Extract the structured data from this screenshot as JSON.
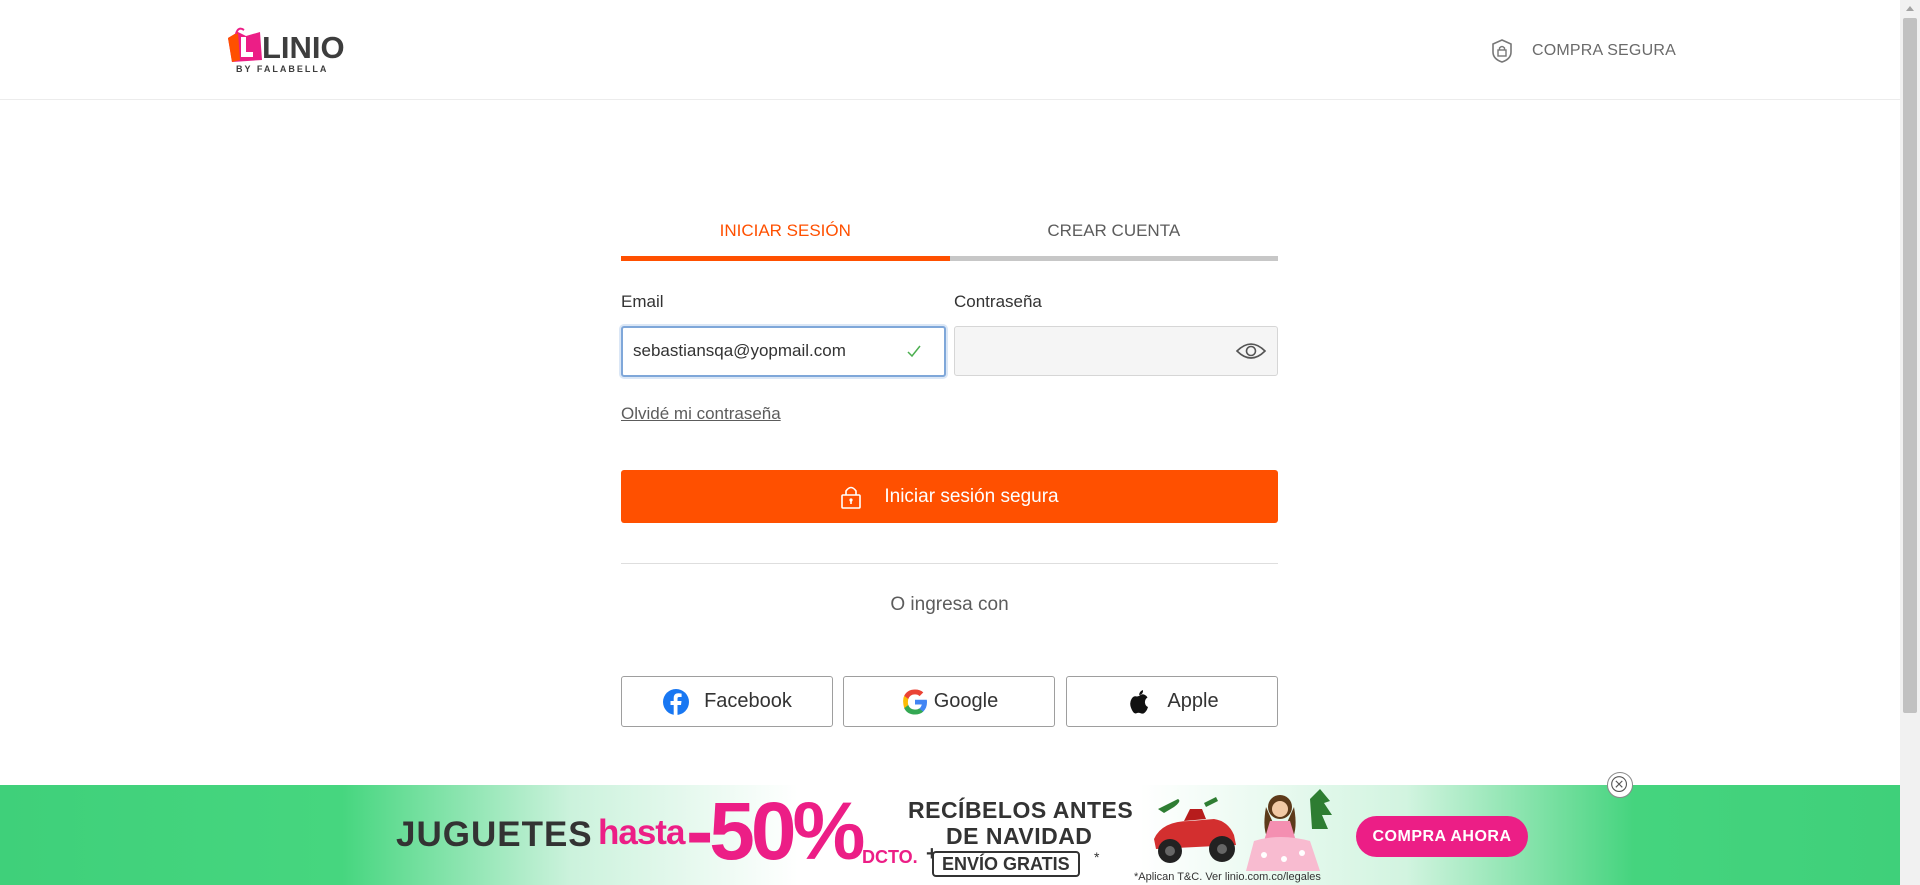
{
  "header": {
    "logo_word": "LINIO",
    "logo_sub": "BY FALABELLA",
    "secure_label": "COMPRA SEGURA"
  },
  "tabs": [
    {
      "label": "INICIAR SESIÓN",
      "active": true
    },
    {
      "label": "CREAR CUENTA",
      "active": false
    }
  ],
  "form": {
    "email_label": "Email",
    "email_value": "sebastiansqa@yopmail.com",
    "password_label": "Contraseña",
    "password_value": "",
    "forgot_label": "Olvidé mi contraseña",
    "submit_label": "Iniciar sesión segura",
    "or_label": "O ingresa con"
  },
  "social": [
    {
      "label": "Facebook",
      "icon": "facebook-icon"
    },
    {
      "label": "Google",
      "icon": "google-icon"
    },
    {
      "label": "Apple",
      "icon": "apple-icon"
    }
  ],
  "banner": {
    "juguetes": "JUGUETES",
    "hasta": "hasta",
    "discount": "-50%",
    "dcto": "DCTO.",
    "receive_line1": "RECÍBELOS ANTES",
    "receive_line2": "DE NAVIDAD",
    "shipping": "ENVÍO GRATIS",
    "legal": "*Aplican T&C. Ver linio.com.co/legales",
    "cta": "COMPRA AHORA"
  },
  "colors": {
    "brand_orange": "#ff5000",
    "banner_pink": "#ec1e86",
    "banner_green": "#3fd07a"
  }
}
